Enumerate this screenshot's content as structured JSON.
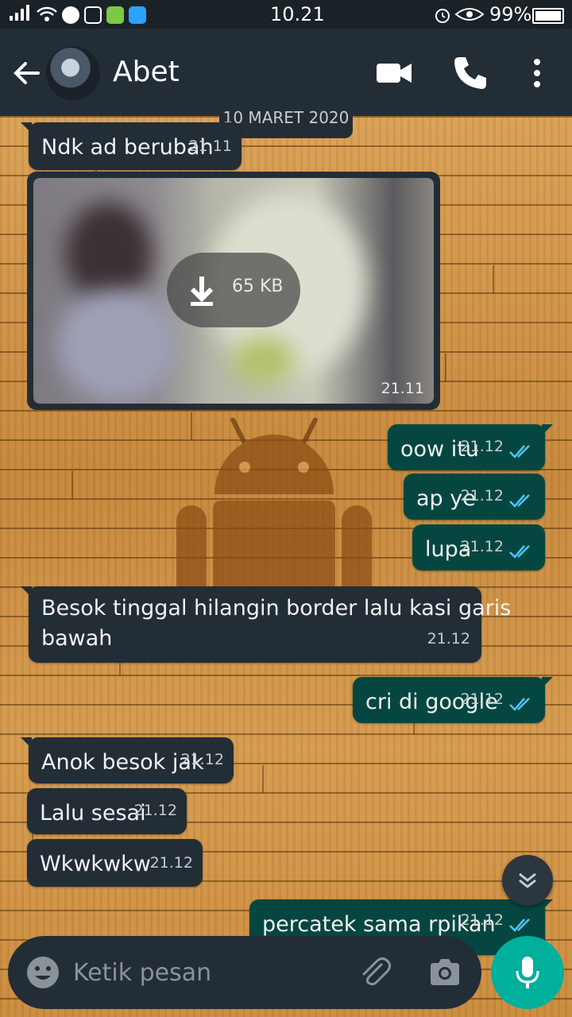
{
  "status_bar": {
    "time": "10.21",
    "battery": "99%"
  },
  "header": {
    "contact_name": "Abet",
    "icons": [
      "back-arrow-icon",
      "video-call-icon",
      "phone-call-icon",
      "more-options-icon"
    ]
  },
  "chat": {
    "date_chip": "10 MARET 2020",
    "messages": [
      {
        "dir": "in",
        "text": "Ndk ad berubah",
        "time": "21.11"
      },
      {
        "dir": "in",
        "type": "image",
        "size": "65 KB",
        "time": "21.11"
      },
      {
        "dir": "out",
        "text": "oow itu",
        "time": "21.12",
        "read": true
      },
      {
        "dir": "out",
        "text": "ap ye",
        "time": "21.12",
        "read": true
      },
      {
        "dir": "out",
        "text": "lupa",
        "time": "21.12",
        "read": true
      },
      {
        "dir": "in",
        "text_line1": "Besok tinggal hilangin border lalu kasi garis",
        "text_line2": "bawah",
        "time": "21.12"
      },
      {
        "dir": "out",
        "text": "cri di google",
        "time": "21.12",
        "read": true
      },
      {
        "dir": "in",
        "text": "Anok besok jak",
        "time": "21.12"
      },
      {
        "dir": "in",
        "text": "Lalu sesai",
        "time": "21.12"
      },
      {
        "dir": "in",
        "text": "Wkwkwkw",
        "time": "21.12"
      },
      {
        "dir": "out",
        "text": "percatek sama rpikan",
        "time": "21.12",
        "read": true
      }
    ]
  },
  "composer": {
    "placeholder": "Ketik pesan"
  },
  "colors": {
    "header": "#232d36",
    "incoming": "#232d36",
    "outgoing": "#054740",
    "accent": "#00af9c",
    "read_tick": "#4fc3f7"
  }
}
